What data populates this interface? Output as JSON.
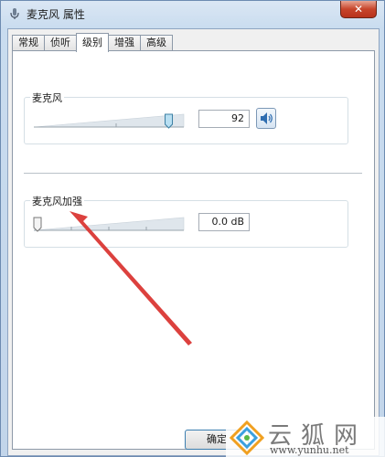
{
  "window": {
    "title": "麦克风 属性",
    "close_label": "✕"
  },
  "tabs": [
    {
      "label": "常规",
      "active": false
    },
    {
      "label": "侦听",
      "active": false
    },
    {
      "label": "级别",
      "active": true
    },
    {
      "label": "增强",
      "active": false
    },
    {
      "label": "高级",
      "active": false
    }
  ],
  "microphone": {
    "label": "麦克风",
    "level": 92,
    "value_text": "92"
  },
  "boost": {
    "label": "麦克风加强",
    "level_fraction": 0,
    "value_text": "0.0 dB"
  },
  "buttons": {
    "ok_label": "确定"
  },
  "watermark": {
    "text": "云狐网",
    "url": "www.yunhu.net"
  },
  "colors": {
    "arrow": "#d9312e",
    "accent": "#3c7fb1"
  },
  "icons": {
    "mute_button": "speaker-icon",
    "title": "microphone-icon"
  }
}
